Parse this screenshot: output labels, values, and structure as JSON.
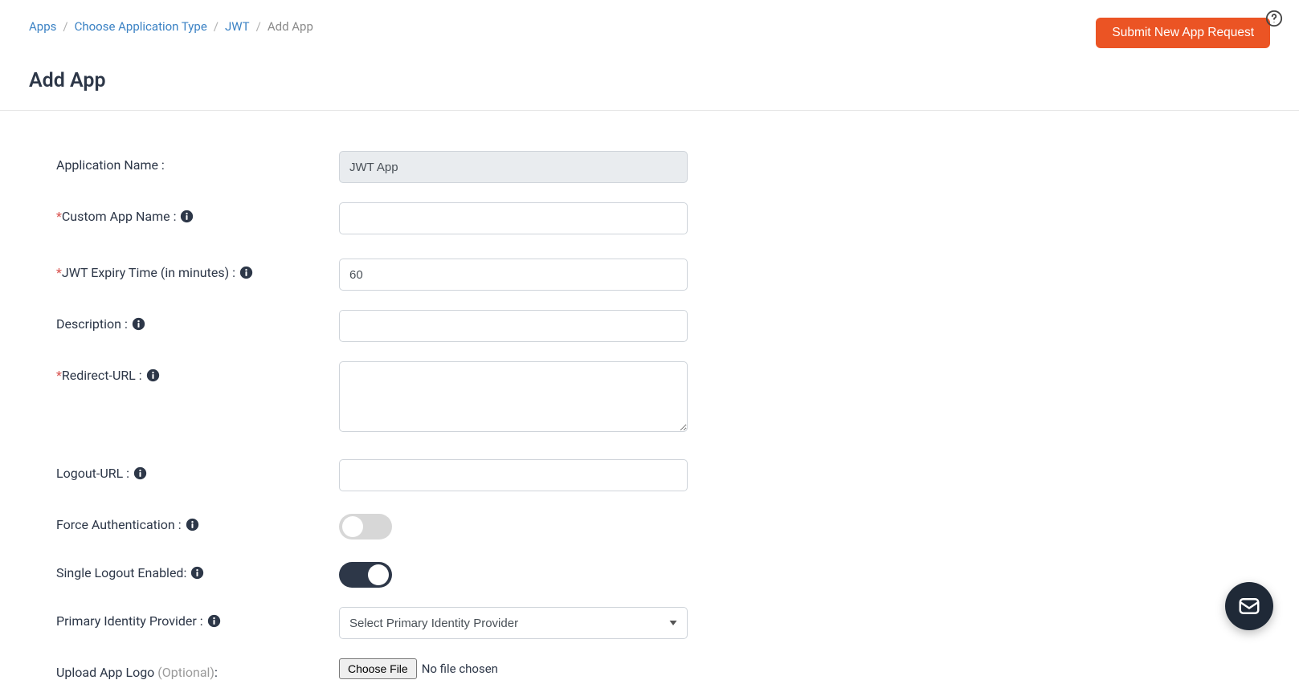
{
  "breadcrumb": {
    "items": [
      "Apps",
      "Choose Application Type",
      "JWT"
    ],
    "current": "Add App"
  },
  "actions": {
    "submit_request": "Submit New App Request"
  },
  "page": {
    "title": "Add App"
  },
  "form": {
    "app_name": {
      "label": "Application Name :",
      "value": "JWT App"
    },
    "custom_name": {
      "label": "Custom App Name :",
      "value": ""
    },
    "jwt_expiry": {
      "label": "JWT Expiry Time (in minutes) :",
      "value": "60"
    },
    "description": {
      "label": "Description :",
      "value": ""
    },
    "redirect_url": {
      "label": "Redirect-URL :",
      "value": ""
    },
    "logout_url": {
      "label": "Logout-URL :",
      "value": ""
    },
    "force_auth": {
      "label": "Force Authentication :",
      "value": false
    },
    "single_logout": {
      "label": "Single Logout Enabled:",
      "value": true
    },
    "primary_idp": {
      "label": "Primary Identity Provider :",
      "placeholder": "Select Primary Identity Provider"
    },
    "upload_logo": {
      "label": "Upload App Logo ",
      "optional": "(Optional)",
      "suffix": ":",
      "button": "Choose File",
      "status": "No file chosen"
    }
  }
}
